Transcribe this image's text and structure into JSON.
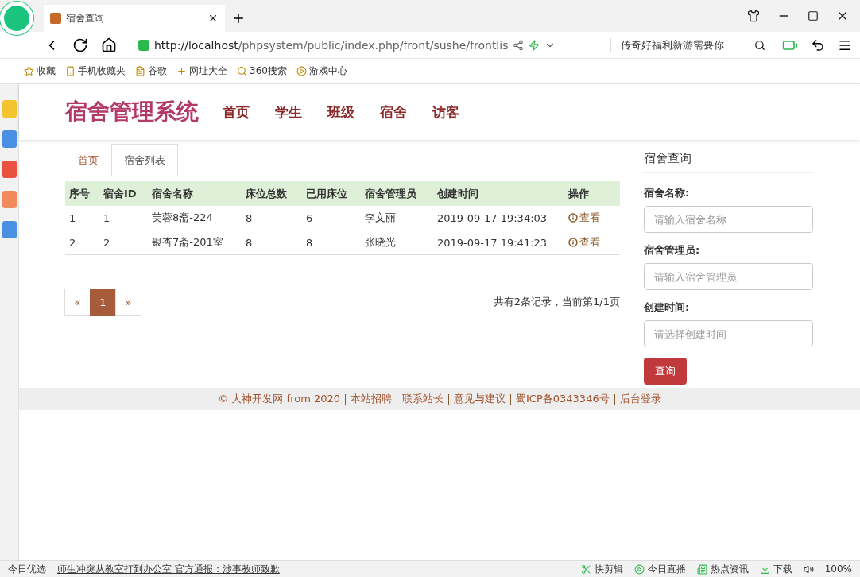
{
  "browser": {
    "tab_title": "宿舍查询",
    "url_host": "http://localhost",
    "url_path": "/phpsystem/public/index.php/front/sushe/frontlis",
    "search": {
      "placeholder": "传奇好福利新游需要你"
    },
    "bookmarks": [
      "收藏",
      "手机收藏夹",
      "谷歌",
      "网址大全",
      "360搜索",
      "游戏中心"
    ]
  },
  "site": {
    "logo": "宿舍管理系统",
    "nav": [
      "首页",
      "学生",
      "班级",
      "宿舍",
      "访客"
    ]
  },
  "breadcrumb_tabs": [
    {
      "label": "首页",
      "selected": false
    },
    {
      "label": "宿舍列表",
      "selected": true
    }
  ],
  "table": {
    "columns": [
      "序号",
      "宿舍ID",
      "宿舍名称",
      "床位总数",
      "已用床位",
      "宿舍管理员",
      "创建时间",
      "操作"
    ],
    "rows": [
      {
        "cells": [
          "1",
          "1",
          "芙蓉8斋-224",
          "8",
          "6",
          "李文丽",
          "2019-09-17 19:34:03"
        ],
        "action": "查看"
      },
      {
        "cells": [
          "2",
          "2",
          "银杏7斋-201室",
          "8",
          "8",
          "张晓光",
          "2019-09-17 19:41:23"
        ],
        "action": "查看"
      }
    ]
  },
  "pagination": [
    {
      "label": "«",
      "selected": false
    },
    {
      "label": "1",
      "selected": true
    },
    {
      "label": "»",
      "selected": false
    }
  ],
  "summary": "共有2条记录，当前第1/1页",
  "search_panel": {
    "title": "宿舍查询",
    "fields": [
      {
        "label": "宿舍名称:",
        "placeholder": "请输入宿舍名称"
      },
      {
        "label": "宿舍管理员:",
        "placeholder": "请输入宿舍管理员"
      },
      {
        "label": "创建时间:",
        "placeholder": "请选择创建时间"
      }
    ],
    "button": "查询"
  },
  "footer": [
    "© 大神开发网 from 2020",
    "本站招聘",
    "联系站长",
    "意见与建议",
    "蜀ICP备0343346号",
    "后台登录"
  ],
  "status_bar": {
    "left": "今日优选",
    "news": "师生冲突从教室打到办公室 官方通报：涉事教师致歉",
    "items": [
      "快剪辑",
      "今日直播",
      "热点资讯",
      "下载"
    ],
    "zoom": "100%"
  }
}
